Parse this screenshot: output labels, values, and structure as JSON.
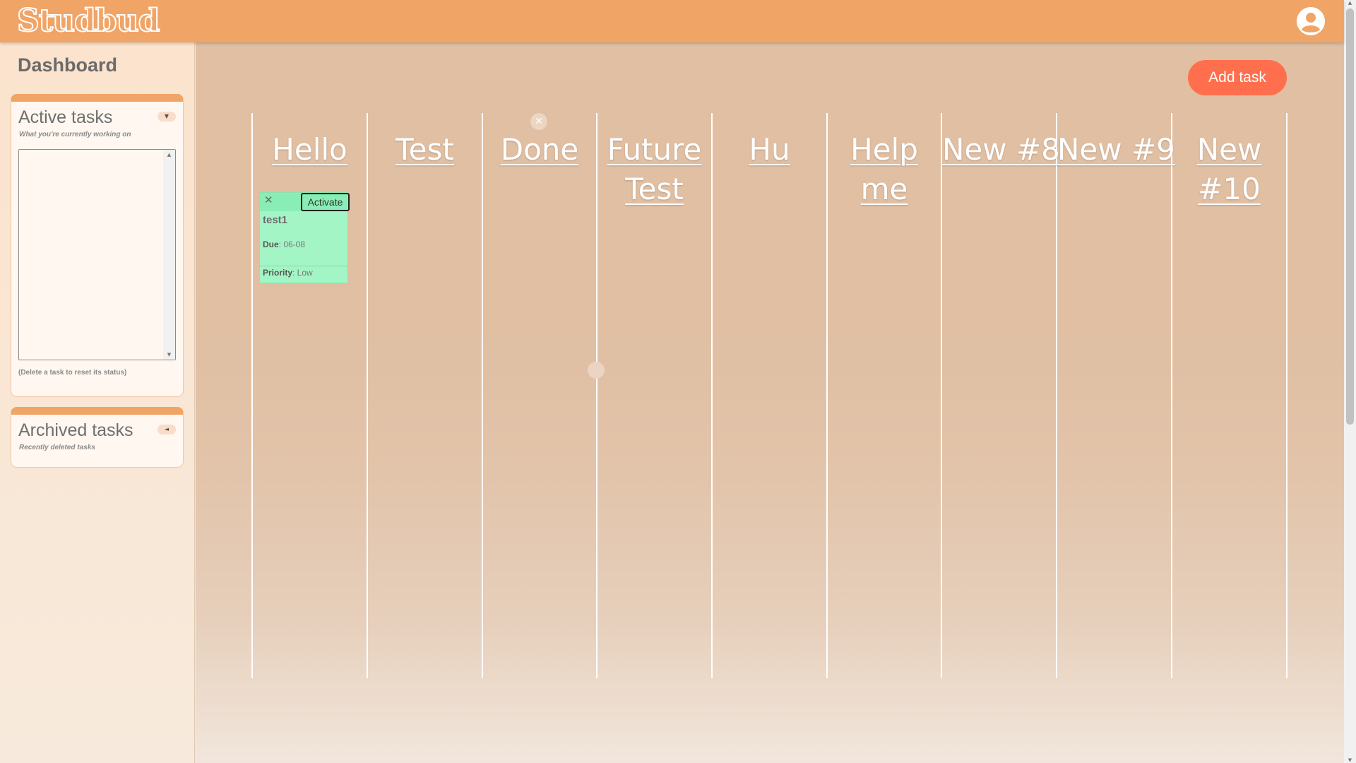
{
  "app": {
    "logo": "Studbud"
  },
  "header": {
    "user_icon": "user-circle-icon"
  },
  "sidebar": {
    "title": "Dashboard",
    "active_panel": {
      "title": "Active tasks",
      "subtitle": "What you're currently working on",
      "toggle_icon": "▼",
      "textarea_value": "",
      "footer": "(Delete a task to reset its status)"
    },
    "archived_panel": {
      "title": "Archived tasks",
      "subtitle": "Recently deleted tasks",
      "toggle_icon": "◄"
    }
  },
  "main": {
    "add_task_label": "Add task",
    "column_delete_icon": "✕",
    "columns": [
      {
        "title": "Hello"
      },
      {
        "title": "Test"
      },
      {
        "title": "Done"
      },
      {
        "title": "Future Test"
      },
      {
        "title": "Hu"
      },
      {
        "title": "Help me"
      },
      {
        "title": "New #8"
      },
      {
        "title": "New #9"
      },
      {
        "title": "New #10"
      }
    ],
    "task": {
      "close_icon": "✕",
      "activate_label": "Activate",
      "name": "test1",
      "due_label": "Due",
      "due_value": ": 06-08",
      "priority_label": "Priority",
      "priority_value": ": Low",
      "color": "#a3f5c6"
    }
  },
  "colors": {
    "header": "#f0a466",
    "accent": "#ff6f4e",
    "card": "#a3f5c6"
  }
}
